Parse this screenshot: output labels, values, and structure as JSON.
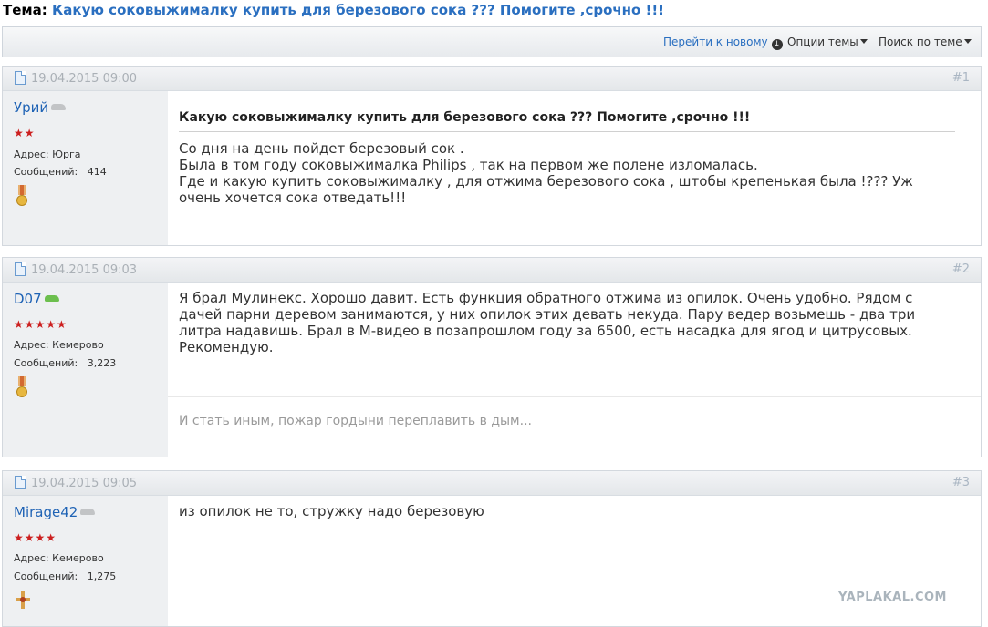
{
  "topic": {
    "label": "Тема:",
    "title": "Какую соковыжималку купить для березового сока ??? Помогите ,срочно !!!"
  },
  "toolbar": {
    "go_new": "Перейти к новому",
    "options": "Опции темы",
    "search": "Поиск по теме"
  },
  "posts": [
    {
      "date": "19.04.2015 09:00",
      "num": "#1",
      "username": "Урий",
      "stars": "★★",
      "address": "Адрес: Юрга",
      "messages_label": "Сообщений:",
      "messages_count": "414",
      "title": "Какую соковыжималку купить для березового сока ??? Помогите ,срочно !!!",
      "lines": [
        "Со дня на день пойдет березовый сок .",
        "Была в том году соковыжималка Philips , так на первом же полене изломалась.",
        "Где и какую купить соковыжималку , для отжима березового сока , штобы крепенькая была !??? Уж",
        "очень хочется сока отведать!!!"
      ]
    },
    {
      "date": "19.04.2015 09:03",
      "num": "#2",
      "username": "D07",
      "stars": "★★★★★",
      "address": "Адрес: Кемерово",
      "messages_label": "Сообщений:",
      "messages_count": "3,223",
      "lines": [
        "Я брал Мулинекс. Хорошо давит. Есть функция обратного отжима из опилок. Очень удобно. Рядом с",
        "дачей парни деревом занимаются, у них опилок этих девать некуда. Пару ведер возьмешь - два три",
        "литра надавишь. Брал в М-видео в позапрошлом году за 6500, есть насадка для ягод и цитрусовых.",
        "Рекомендую."
      ],
      "signature": "И стать иным, пожар гордыни переплавить в дым..."
    },
    {
      "date": "19.04.2015 09:05",
      "num": "#3",
      "username": "Mirage42",
      "stars": "★★★★",
      "address": "Адрес: Кемерово",
      "messages_label": "Сообщений:",
      "messages_count": "1,275",
      "lines": [
        "из опилок не то, стружку надо березовую"
      ]
    }
  ],
  "watermark": "YAPLAKAL.COM",
  "colors": {
    "link": "#2a6fc0",
    "username": "#1f63b5",
    "stars": "#cc1f1f"
  }
}
